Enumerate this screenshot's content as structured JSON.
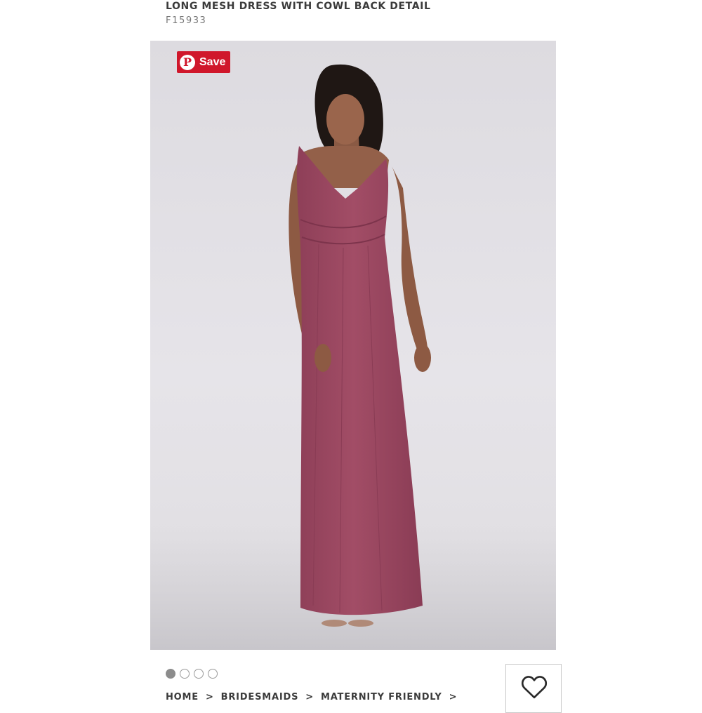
{
  "product": {
    "title": "LONG MESH DRESS WITH COWL BACK DETAIL",
    "sku": "F15933"
  },
  "image": {
    "alt": "Model wearing long mesh dress with cowl back detail",
    "dress_color": "#a24d66",
    "pin_button": {
      "label": "Save",
      "logo": "P",
      "color": "#d0172b"
    }
  },
  "carousel": {
    "total": 4,
    "active_index": 0
  },
  "breadcrumb": {
    "items": [
      "HOME",
      "BRIDESMAIDS",
      "MATERNITY FRIENDLY"
    ],
    "separator": ">"
  },
  "wishlist": {
    "icon": "heart-icon"
  }
}
